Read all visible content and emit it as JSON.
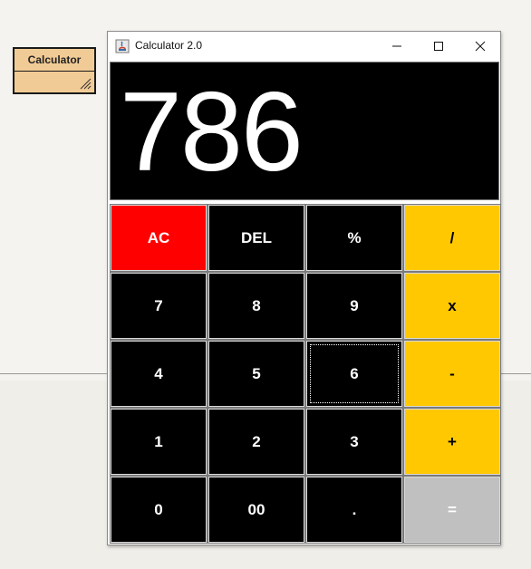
{
  "background": {
    "class_box": {
      "name": "Calculator"
    }
  },
  "window": {
    "title": "Calculator 2.0",
    "icon": "java-app-icon",
    "controls": {
      "minimize": "minimize-icon",
      "maximize": "maximize-icon",
      "close": "close-icon"
    }
  },
  "display": {
    "value": "786"
  },
  "keys": {
    "ac": "AC",
    "del": "DEL",
    "percent": "%",
    "divide": "/",
    "seven": "7",
    "eight": "8",
    "nine": "9",
    "multiply": "x",
    "four": "4",
    "five": "5",
    "six": "6",
    "minus": "-",
    "one": "1",
    "two": "2",
    "three": "3",
    "plus": "+",
    "zero": "0",
    "double_zero": "00",
    "dot": ".",
    "equals": "="
  },
  "colors": {
    "clear": "#ff0000",
    "operator": "#ffc800",
    "equals": "#c0c0c0",
    "digit": "#000000",
    "class_box": "#f1cb96"
  }
}
